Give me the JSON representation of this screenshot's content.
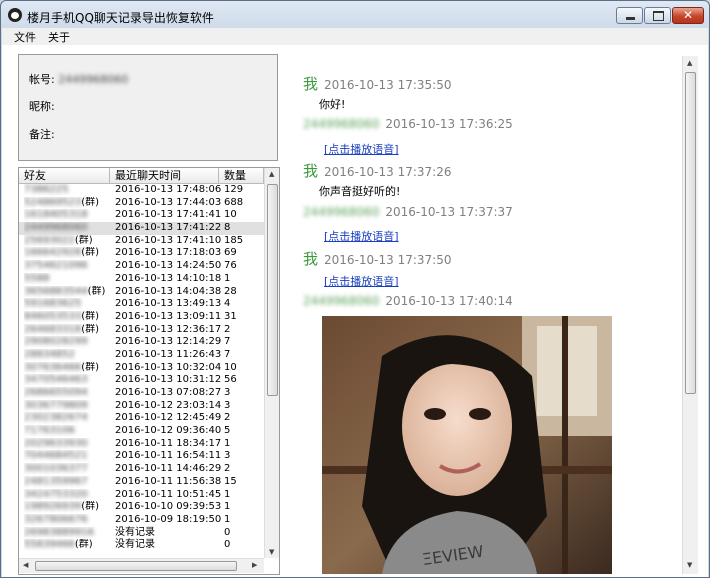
{
  "window": {
    "title": "楼月手机QQ聊天记录导出恢复软件"
  },
  "menu": [
    "文件",
    "关于"
  ],
  "account": {
    "account_label": "帐号:",
    "account_value": "2449968060",
    "nickname_label": "昵称:",
    "remark_label": "备注:"
  },
  "friends": {
    "columns": [
      "好友",
      "最近聊天时间",
      "数量"
    ],
    "rows": [
      {
        "friend": "7386225",
        "time": "2016-10-13 17:48:06",
        "count": "129"
      },
      {
        "friend": "524869523(群)",
        "time": "2016-10-13 17:44:03",
        "count": "688"
      },
      {
        "friend": "1618405318",
        "time": "2016-10-13 17:41:41",
        "count": "10"
      },
      {
        "friend": "2449968060",
        "time": "2016-10-13 17:41:22",
        "count": "8"
      },
      {
        "friend": "25693022(群)",
        "time": "2016-10-13 17:41:10",
        "count": "185"
      },
      {
        "friend": "166642928(群)",
        "time": "2016-10-13 17:18:03",
        "count": "69"
      },
      {
        "friend": "3754621096",
        "time": "2016-10-13 14:24:50",
        "count": "76"
      },
      {
        "friend": "5588",
        "time": "2016-10-13 14:10:18",
        "count": "1"
      },
      {
        "friend": "3656883544(群)",
        "time": "2016-10-13 14:04:38",
        "count": "28"
      },
      {
        "friend": "591683625",
        "time": "2016-10-13 13:49:13",
        "count": "4"
      },
      {
        "friend": "846053533(群)",
        "time": "2016-10-13 13:09:11",
        "count": "31"
      },
      {
        "friend": "264683318(群)",
        "time": "2016-10-13 12:36:17",
        "count": "2"
      },
      {
        "friend": "2908028299",
        "time": "2016-10-13 12:14:29",
        "count": "7"
      },
      {
        "friend": "28834852",
        "time": "2016-10-13 11:26:43",
        "count": "7"
      },
      {
        "friend": "307636466(群)",
        "time": "2016-10-13 10:32:04",
        "count": "10"
      },
      {
        "friend": "3470546463",
        "time": "2016-10-13 10:31:12",
        "count": "56"
      },
      {
        "friend": "2686655094",
        "time": "2016-10-13 07:08:27",
        "count": "3"
      },
      {
        "friend": "3036779809",
        "time": "2016-10-12 23:03:14",
        "count": "3"
      },
      {
        "friend": "2302382674",
        "time": "2016-10-12 12:45:49",
        "count": "2"
      },
      {
        "friend": "71763106",
        "time": "2016-10-12 09:36:40",
        "count": "5"
      },
      {
        "friend": "2029633930",
        "time": "2016-10-11 18:34:17",
        "count": "1"
      },
      {
        "friend": "7044684521",
        "time": "2016-10-11 16:54:11",
        "count": "3"
      },
      {
        "friend": "3001036377",
        "time": "2016-10-11 14:46:29",
        "count": "2"
      },
      {
        "friend": "2481359967",
        "time": "2016-10-11 11:56:38",
        "count": "15"
      },
      {
        "friend": "3424753320",
        "time": "2016-10-11 10:51:45",
        "count": "1"
      },
      {
        "friend": "198926939(群)",
        "time": "2016-10-10 09:39:53",
        "count": "1"
      },
      {
        "friend": "3267806676",
        "time": "2016-10-09 18:19:50",
        "count": "1"
      },
      {
        "friend": "26983889916",
        "time": "没有记录",
        "count": "0"
      },
      {
        "friend": "55839466(群)",
        "time": "没有记录",
        "count": "0"
      }
    ]
  },
  "chat": {
    "messages": [
      {
        "sender": "我",
        "time": "2016-10-13 17:35:50",
        "text": "你好!"
      },
      {
        "sender": "2449968060",
        "time": "2016-10-13 17:36:25",
        "link": "[点击播放语音]"
      },
      {
        "sender": "我",
        "time": "2016-10-13 17:37:26",
        "text": "你声音挺好听的!"
      },
      {
        "sender": "2449968060",
        "time": "2016-10-13 17:37:37",
        "link": "[点击播放语音]"
      },
      {
        "sender": "我",
        "time": "2016-10-13 17:37:50",
        "link": "[点击播放语音]"
      },
      {
        "sender": "2449968060",
        "time": "2016-10-13 17:40:14"
      }
    ]
  }
}
